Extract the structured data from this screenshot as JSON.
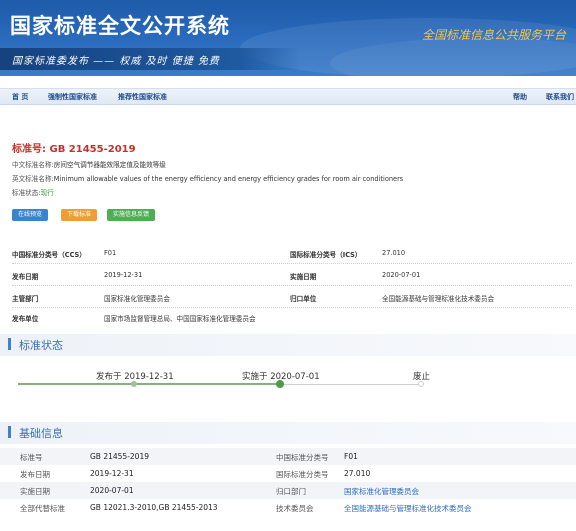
{
  "banner": {
    "title": "国家标准全文公开系统",
    "subtitle": "国家标准委发布 —— 权威 及时 便捷 免费",
    "slogan": "全国标准信息公共服务平台"
  },
  "nav": {
    "items": [
      {
        "label": "首 页"
      },
      {
        "label": "强制性国家标准"
      },
      {
        "label": "推荐性国家标准"
      },
      {
        "label": "帮助"
      },
      {
        "label": "联系我们"
      }
    ]
  },
  "standard": {
    "number_label": "标准号:",
    "number": "GB 21455-2019",
    "cn_name_label": "中文标准名称:",
    "cn_name": "房间空气调节器能效限定值及能效等级",
    "en_name_label": "英文标准名称:",
    "en_name": "Minimum allowable values of the energy efficiency and energy efficiency grades for room air conditioners",
    "status_label": "标准状态:",
    "status": "现行"
  },
  "actions": {
    "preview": "在线预览",
    "download": "下载标准",
    "feedback": "实施信息反馈"
  },
  "details": {
    "ccs_label": "中国标准分类号（CCS）",
    "ccs": "F01",
    "ics_label": "国际标准分类号（ICS）",
    "ics": "27.010",
    "publish_label": "发布日期",
    "publish": "2019-12-31",
    "impl_label": "实施日期",
    "impl": "2020-07-01",
    "dept_label": "主管部门",
    "dept": "国家标准化管理委员会",
    "owner_label": "归口单位",
    "owner": "全国能源基础与管理标准化技术委员会",
    "issuer_label": "发布单位",
    "issuer": "国家市场监督管理总局、中国国家标准化管理委员会"
  },
  "status_section": {
    "title": "标准状态",
    "steps": [
      {
        "label": "发布于 2019-12-31",
        "state": "done"
      },
      {
        "label": "实施于 2020-07-01",
        "state": "current"
      },
      {
        "label": "废止",
        "state": "pending"
      }
    ],
    "colors": {
      "done": "#86b17f",
      "current": "#4e9a4a",
      "pending": "#cfcfcf"
    }
  },
  "basic_section": {
    "title": "基础信息",
    "rows": [
      {
        "l1": "标准号",
        "v1": "GB 21455-2019",
        "l2": "中国标准分类号",
        "v2": "F01"
      },
      {
        "l1": "发布日期",
        "v1": "2019-12-31",
        "l2": "国际标准分类号",
        "v2": "27.010"
      },
      {
        "l1": "实施日期",
        "v1": "2020-07-01",
        "l2": "归口部门",
        "v2": "国家标准化管理委员会"
      },
      {
        "l1": "全部代替标准",
        "v1": "GB 12021.3-2010,GB 21455-2013",
        "l2": "技术委员会",
        "v2": "全国能源基础与管理标准化技术委员会"
      }
    ]
  },
  "colors": {
    "accent": "#2b6cbe",
    "std_number": "#c6322b",
    "status_current": "#2e9d41"
  }
}
